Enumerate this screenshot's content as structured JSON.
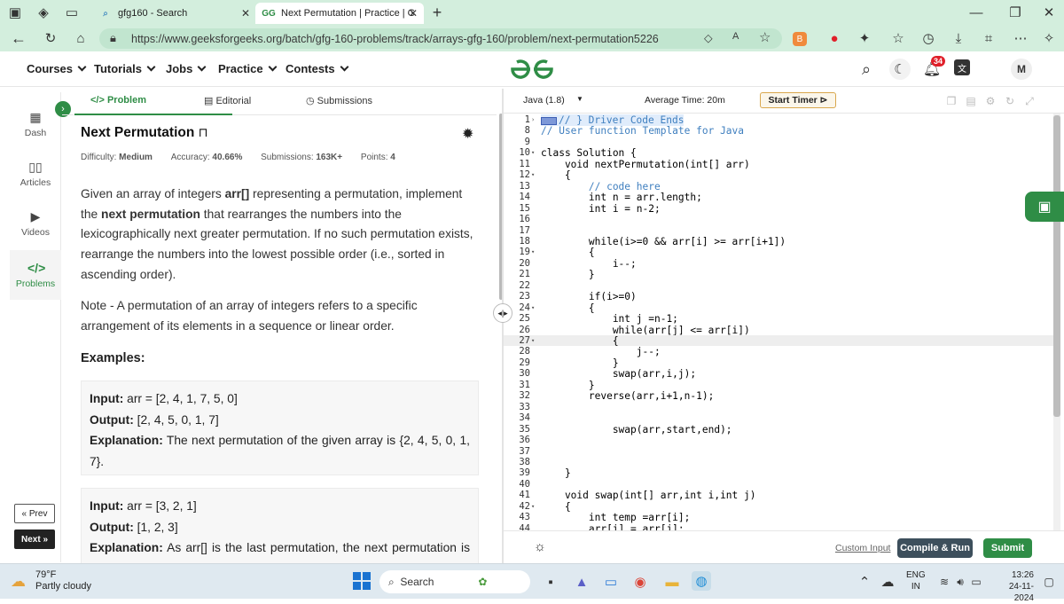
{
  "browser": {
    "tabs": [
      {
        "title": "gfg160 - Search",
        "active": false
      },
      {
        "title": "Next Permutation | Practice | Geek",
        "active": true
      }
    ],
    "url": "https://www.geeksforgeeks.org/batch/gfg-160-problems/track/arrays-gfg-160/problem/next-permutation5226",
    "new_tab": "+"
  },
  "site": {
    "nav": [
      "Courses",
      "Tutorials",
      "Jobs",
      "Practice",
      "Contests"
    ],
    "logo": "GfG",
    "notifications": "34",
    "avatar": "M"
  },
  "sidebar": {
    "items": [
      {
        "label": "Dash",
        "icon": "dashboard-icon"
      },
      {
        "label": "Articles",
        "icon": "book-icon"
      },
      {
        "label": "Videos",
        "icon": "video-icon"
      },
      {
        "label": "Problems",
        "icon": "code-icon"
      }
    ],
    "prev_label": "« Prev",
    "next_label": "Next »"
  },
  "problem_tabs": {
    "problem": "</> Problem",
    "editorial": "Editorial",
    "submissions": "Submissions"
  },
  "problem": {
    "title": "Next Permutation",
    "difficulty_label": "Difficulty:",
    "difficulty": "Medium",
    "accuracy_label": "Accuracy:",
    "accuracy": "40.66%",
    "submissions_label": "Submissions:",
    "submissions": "163K+",
    "points_label": "Points:",
    "points": "4",
    "desc_1": "Given an array of integers",
    "desc_arr": "arr[]",
    "desc_2": "representing a permutation, implement the",
    "desc_np": "next permutation",
    "desc_3": "that rearranges the numbers into the lexicographically next greater permutation. If no such permutation exists, rearrange the numbers into the lowest possible order (i.e., sorted in ascending order).",
    "note": "Note - A permutation of an array of integers refers to a specific arrangement of its elements in a sequence or linear order.",
    "examples_heading": "Examples:",
    "examples": [
      {
        "input": "arr = [2, 4, 1, 7, 5, 0]",
        "output": "[2, 4, 5, 0, 1, 7]",
        "explanation": "The next permutation of the given array is {2, 4, 5, 0, 1, 7}."
      },
      {
        "input": "arr = [3, 2, 1]",
        "output": "[1, 2, 3]",
        "explanation": "As arr[] is the last permutation, the next permutation is the lowest one."
      }
    ],
    "input_label": "Input:",
    "output_label": "Output:",
    "explanation_label": "Explanation:"
  },
  "editor": {
    "language": "Java (1.8)",
    "avg_time": "Average Time: 20m",
    "start_timer": "Start Timer",
    "lines": [
      {
        "n": "1",
        "fold": "›",
        "text": "// } Driver Code Ends",
        "cls": "comment",
        "highlight": true
      },
      {
        "n": "8",
        "text": "// User function Template for Java",
        "cls": "comment"
      },
      {
        "n": "9",
        "text": ""
      },
      {
        "n": "10",
        "fold": "▾",
        "text": "class Solution {"
      },
      {
        "n": "11",
        "text": "    void nextPermutation(int[] arr)"
      },
      {
        "n": "12",
        "fold": "▾",
        "text": "    {"
      },
      {
        "n": "13",
        "text": "        // code here",
        "cls": "comment"
      },
      {
        "n": "14",
        "text": "        int n = arr.length;"
      },
      {
        "n": "15",
        "text": "        int i = n-2;"
      },
      {
        "n": "16",
        "text": ""
      },
      {
        "n": "17",
        "text": ""
      },
      {
        "n": "18",
        "text": "        while(i>=0 && arr[i] >= arr[i+1])"
      },
      {
        "n": "19",
        "fold": "▾",
        "text": "        {"
      },
      {
        "n": "20",
        "text": "            i--;"
      },
      {
        "n": "21",
        "text": "        }"
      },
      {
        "n": "22",
        "text": ""
      },
      {
        "n": "23",
        "text": "        if(i>=0)"
      },
      {
        "n": "24",
        "fold": "▾",
        "text": "        {"
      },
      {
        "n": "25",
        "text": "            int j =n-1;"
      },
      {
        "n": "26",
        "text": "            while(arr[j] <= arr[i])"
      },
      {
        "n": "27",
        "fold": "▾",
        "text": "            {",
        "current": true
      },
      {
        "n": "28",
        "text": "                j--;"
      },
      {
        "n": "29",
        "text": "            }"
      },
      {
        "n": "30",
        "text": "            swap(arr,i,j);"
      },
      {
        "n": "31",
        "text": "        }"
      },
      {
        "n": "32",
        "text": "        reverse(arr,i+1,n-1);"
      },
      {
        "n": "33",
        "text": ""
      },
      {
        "n": "34",
        "text": ""
      },
      {
        "n": "35",
        "text": "            swap(arr,start,end);"
      },
      {
        "n": "36",
        "text": ""
      },
      {
        "n": "37",
        "text": ""
      },
      {
        "n": "38",
        "text": ""
      },
      {
        "n": "39",
        "text": "    }"
      },
      {
        "n": "40",
        "text": ""
      },
      {
        "n": "41",
        "text": "    void swap(int[] arr,int i,int j)"
      },
      {
        "n": "42",
        "fold": "▾",
        "text": "    {"
      },
      {
        "n": "43",
        "text": "        int temp =arr[i];"
      },
      {
        "n": "44",
        "text": "        arr[i] = arr[j];"
      }
    ],
    "custom_input": "Custom Input",
    "compile_run": "Compile & Run",
    "submit": "Submit"
  },
  "taskbar": {
    "weather_temp": "79°F",
    "weather_desc": "Partly cloudy",
    "search_placeholder": "Search",
    "lang_1": "ENG",
    "lang_2": "IN",
    "time": "13:26",
    "date": "24-11-2024"
  },
  "colors": {
    "gfg_green": "#2f8d46",
    "browser_chrome": "#d3eedd",
    "submit_green": "#2f8d46",
    "compile_gray": "#3d4f5c"
  }
}
